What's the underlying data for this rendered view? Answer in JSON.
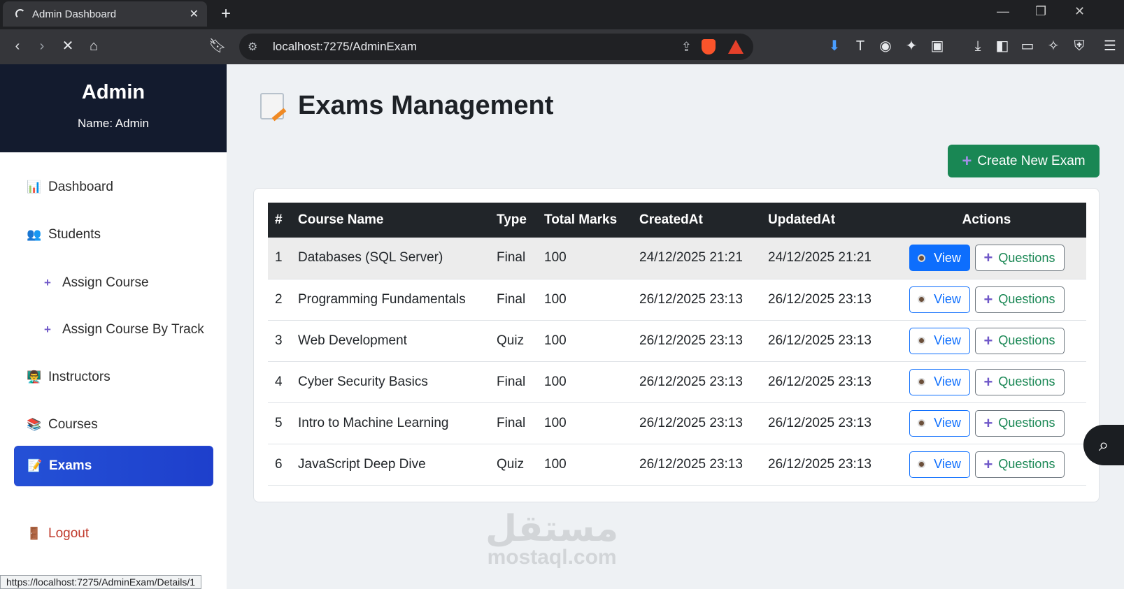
{
  "browser": {
    "tab_title": "Admin Dashboard",
    "url": "localhost:7275/AdminExam",
    "status_url": "https://localhost:7275/AdminExam/Details/1"
  },
  "sidebar": {
    "role": "Admin",
    "name": "Name: Admin",
    "items": [
      {
        "label": "Dashboard",
        "icon": "bar-chart-icon"
      },
      {
        "label": "Students",
        "icon": "people-icon"
      },
      {
        "label": "Assign Course",
        "icon": "plus-icon"
      },
      {
        "label": "Assign Course By Track",
        "icon": "plus-icon"
      },
      {
        "label": "Instructors",
        "icon": "teacher-icon"
      },
      {
        "label": "Courses",
        "icon": "books-icon"
      },
      {
        "label": "Exams",
        "icon": "memo-icon"
      },
      {
        "label": "Logout",
        "icon": "door-icon"
      }
    ]
  },
  "main": {
    "title": "Exams Management",
    "create_button": "Create New Exam",
    "columns": [
      "#",
      "Course Name",
      "Type",
      "Total Marks",
      "CreatedAt",
      "UpdatedAt",
      "Actions"
    ],
    "view_label": "View",
    "questions_label": "Questions",
    "rows": [
      {
        "id": "1",
        "course": "Databases (SQL Server)",
        "type": "Final",
        "marks": "100",
        "created": "24/12/2025 21:21",
        "updated": "24/12/2025 21:21"
      },
      {
        "id": "2",
        "course": "Programming Fundamentals",
        "type": "Final",
        "marks": "100",
        "created": "26/12/2025 23:13",
        "updated": "26/12/2025 23:13"
      },
      {
        "id": "3",
        "course": "Web Development",
        "type": "Quiz",
        "marks": "100",
        "created": "26/12/2025 23:13",
        "updated": "26/12/2025 23:13"
      },
      {
        "id": "4",
        "course": "Cyber Security Basics",
        "type": "Final",
        "marks": "100",
        "created": "26/12/2025 23:13",
        "updated": "26/12/2025 23:13"
      },
      {
        "id": "5",
        "course": "Intro to Machine Learning",
        "type": "Final",
        "marks": "100",
        "created": "26/12/2025 23:13",
        "updated": "26/12/2025 23:13"
      },
      {
        "id": "6",
        "course": "JavaScript Deep Dive",
        "type": "Quiz",
        "marks": "100",
        "created": "26/12/2025 23:13",
        "updated": "26/12/2025 23:13"
      }
    ]
  },
  "watermark": {
    "arabic": "مستقل",
    "latin": "mostaql.com"
  },
  "colors": {
    "sidebar_header": "#131b2e",
    "active_nav": "#2451d6",
    "create_button": "#198754",
    "table_header": "#212529",
    "view_button": "#0d6efd"
  }
}
